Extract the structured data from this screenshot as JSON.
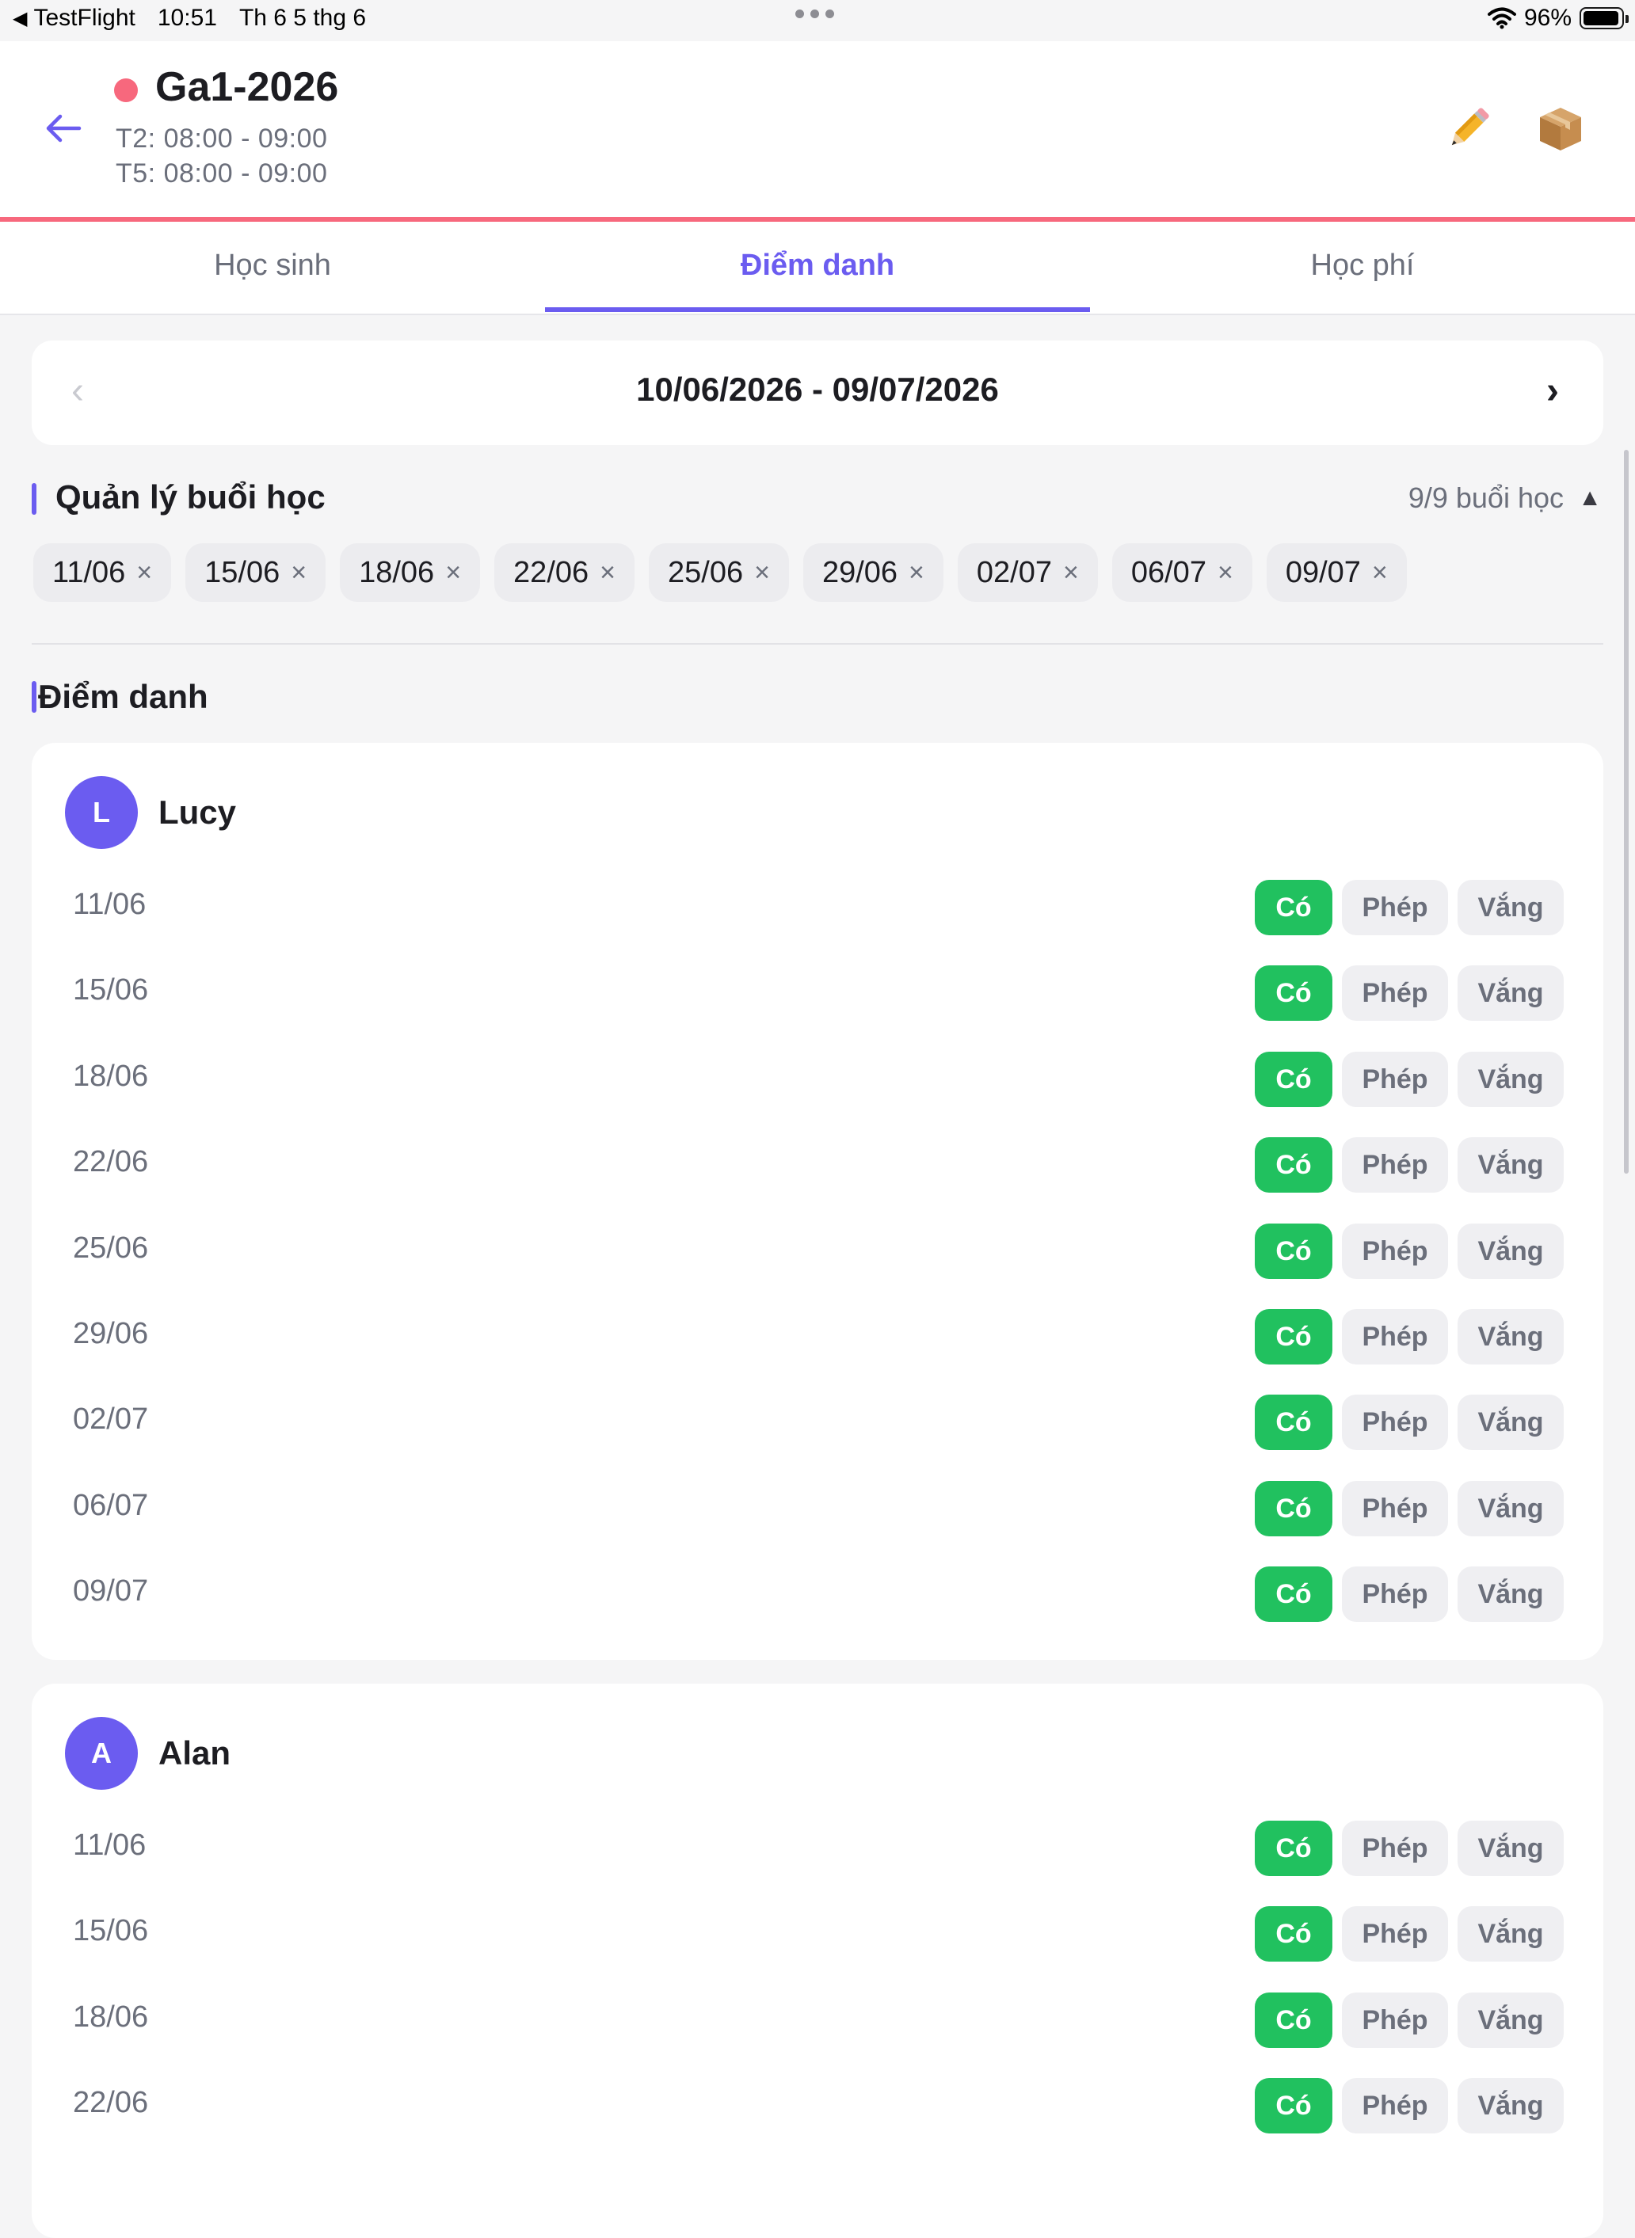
{
  "status_bar": {
    "back_app": "TestFlight",
    "time": "10:51",
    "date": "Th 6 5 thg 6",
    "battery": "96%",
    "icons": [
      "back-triangle-icon",
      "wifi-icon",
      "battery-icon"
    ]
  },
  "header": {
    "title": "Ga1-2026",
    "status_color": "#f7687d",
    "schedule": [
      "T2: 08:00 - 09:00",
      "T5: 08:00 - 09:00"
    ],
    "icons": [
      "back-arrow-icon",
      "pencil-icon",
      "package-icon"
    ]
  },
  "tabs": [
    {
      "label": "Học sinh",
      "active": false
    },
    {
      "label": "Điểm danh",
      "active": true
    },
    {
      "label": "Học phí",
      "active": false
    }
  ],
  "date_range": {
    "label": "10/06/2026 - 09/07/2026",
    "prev_icon": "chevron-left-icon",
    "next_icon": "chevron-right-icon"
  },
  "session_manager": {
    "title": "Quản lý buổi học",
    "count": "9/9 buổi học",
    "toggle_icon": "collapse-up-icon",
    "sessions": [
      "11/06",
      "15/06",
      "18/06",
      "22/06",
      "25/06",
      "29/06",
      "02/07",
      "06/07",
      "09/07"
    ],
    "remove_glyph": "×"
  },
  "attendance": {
    "title": "Điểm danh",
    "options": {
      "present": "Có",
      "excused": "Phép",
      "absent": "Vắng"
    },
    "colors": {
      "accent": "#6b5cf0",
      "present": "#21c15f"
    },
    "students": [
      {
        "initial": "L",
        "name": "Lucy",
        "records": [
          {
            "date": "11/06",
            "status": "Có"
          },
          {
            "date": "15/06",
            "status": "Có"
          },
          {
            "date": "18/06",
            "status": "Có"
          },
          {
            "date": "22/06",
            "status": "Có"
          },
          {
            "date": "25/06",
            "status": "Có"
          },
          {
            "date": "29/06",
            "status": "Có"
          },
          {
            "date": "02/07",
            "status": "Có"
          },
          {
            "date": "06/07",
            "status": "Có"
          },
          {
            "date": "09/07",
            "status": "Có"
          }
        ]
      },
      {
        "initial": "A",
        "name": "Alan",
        "records": [
          {
            "date": "11/06",
            "status": "Có"
          },
          {
            "date": "15/06",
            "status": "Có"
          },
          {
            "date": "18/06",
            "status": "Có"
          },
          {
            "date": "22/06",
            "status": "Có"
          }
        ]
      }
    ]
  }
}
